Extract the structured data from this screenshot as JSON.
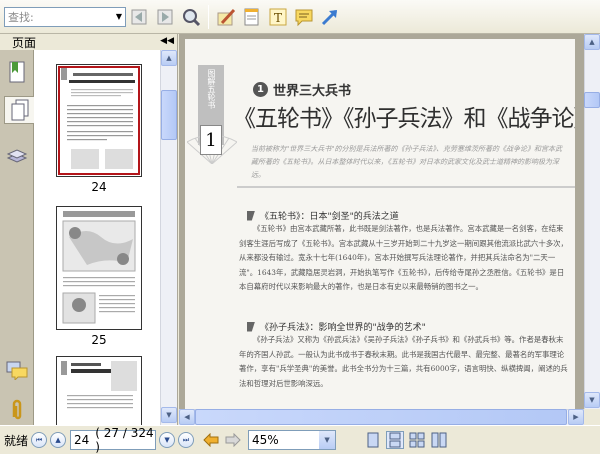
{
  "toolbar": {
    "search_placeholder": "查找:",
    "icons": [
      "search-dropdown-icon",
      "find-previous-icon",
      "find-next-icon",
      "zoom-icon",
      "highlight-icon",
      "note-icon",
      "text-tool-icon",
      "comment-icon",
      "arrow-tool-icon"
    ]
  },
  "sidebar": {
    "title": "页面",
    "tabs": [
      "bookmarks-tab",
      "pages-tab",
      "layers-tab",
      "comments-tab",
      "attachments-tab"
    ],
    "thumbnails": [
      {
        "label": "24",
        "selected": true
      },
      {
        "label": "25",
        "selected": false
      },
      {
        "label": "",
        "selected": false
      }
    ]
  },
  "document": {
    "banner_text": "图解五轮书",
    "chapter_number": "1",
    "section_number": "1",
    "section_title": "世界三大兵书",
    "main_title": "《五轮书》《孙子兵法》和《战争论》",
    "intro": "当前被称为\"世界三大兵书\"的分别是兵法所著的《孙子兵法》、克劳塞维茨所著的《战争论》和宫本武藏所著的《五轮书》。从日本整体时代以来，《五轮书》对日本的武家文化及武士道精神的影响极为深远。",
    "heading1": "《五轮书》：日本\"剑圣\"的兵法之道",
    "para1": "《五轮书》由宫本武藏所著，此书既是剑法著作，也是兵法著作。宫本武藏是一名剑客，在结束剑客生涯后写成了《五轮书》。宫本武藏从十三岁开始到二十九岁这一期间跟其他流派比武六十多次，从来都没有输过。宽永十七年(1640年)，宫本开始撰写兵法理论著作，并把其兵法命名为\"二天一流\"。1643年，武藏隐居灵岩洞，开始执笔写作《五轮书》，后传给寺尾孙之丞胜信。《五轮书》是日本自幕府时代以来影响最大的著作，也是日本有史以来最畅销的图书之一。",
    "heading2": "《孙子兵法》：影响全世界的\"战争的艺术\"",
    "para2": "《孙子兵法》又称为《孙武兵法》《吴孙子兵法》《孙子兵书》和《孙武兵书》等。作者是春秋末年的齐国人孙武。一般认为此书成书于春秋末期。此书是我国古代最早、最完整、最著名的军事理论著作，享有\"兵学圣典\"的美誉。此书全书分为十三篇，共有6000字，语言明快、纵横捭阖，阐述的兵法和哲理对后世影响深远。"
  },
  "status": {
    "ready": "就绪",
    "page_current": "24",
    "page_info": "( 27 / 324 )",
    "zoom": "45%",
    "view_modes": [
      "single-page-view-icon",
      "continuous-view-icon",
      "facing-view-icon",
      "continuous-facing-view-icon"
    ]
  }
}
